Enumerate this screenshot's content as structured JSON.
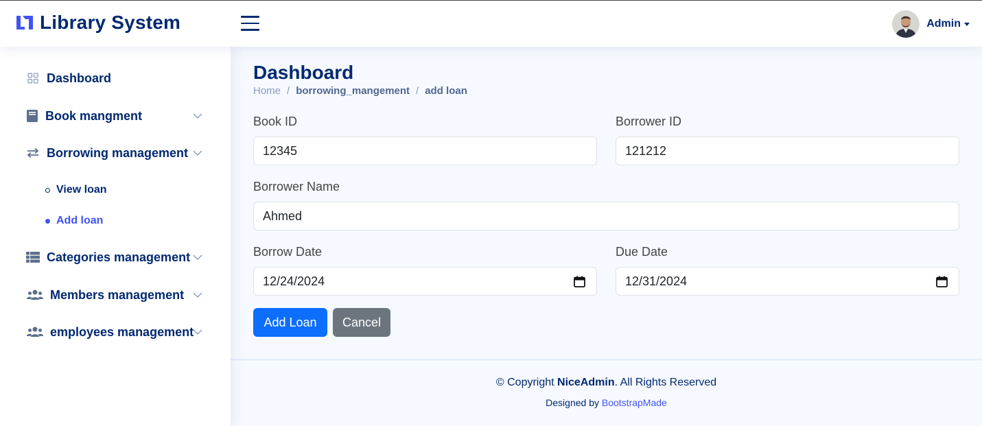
{
  "header": {
    "app_title": "Library System",
    "user_name": "Admin"
  },
  "sidebar": {
    "items": [
      {
        "label": "Dashboard",
        "icon": "grid-icon"
      },
      {
        "label": "Book mangment",
        "icon": "book-icon"
      },
      {
        "label": "Borrowing management",
        "icon": "arrows-icon"
      },
      {
        "label": "Categories management",
        "icon": "table-icon"
      },
      {
        "label": "Members management",
        "icon": "people-icon"
      },
      {
        "label": "employees management",
        "icon": "people-icon"
      }
    ],
    "sub_items": [
      {
        "label": "View loan",
        "active": false
      },
      {
        "label": "Add loan",
        "active": true
      }
    ]
  },
  "main": {
    "title": "Dashboard",
    "breadcrumb": [
      "Home",
      "borrowing_mangement",
      "add loan"
    ],
    "form": {
      "book_id_label": "Book ID",
      "book_id_value": "12345",
      "borrower_id_label": "Borrower ID",
      "borrower_id_value": "121212",
      "borrower_name_label": "Borrower Name",
      "borrower_name_value": "Ahmed",
      "borrow_date_label": "Borrow Date",
      "borrow_date_value": "12/24/2024",
      "due_date_label": "Due Date",
      "due_date_value": "12/31/2024",
      "submit_label": "Add Loan",
      "cancel_label": "Cancel"
    }
  },
  "footer": {
    "copy_prefix": "© Copyright ",
    "brand": "NiceAdmin",
    "copy_suffix": ". All Rights Reserved",
    "designed_by": "Designed by ",
    "designer": "BootstrapMade"
  },
  "colors": {
    "accent": "#4154f1",
    "navy": "#012970",
    "primary_button": "#0d6efd",
    "secondary_button": "#6c757d"
  }
}
